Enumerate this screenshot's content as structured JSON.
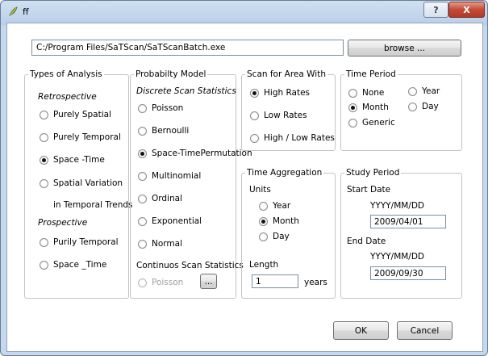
{
  "window": {
    "title": "ff",
    "help_label": "?",
    "close_label": "X"
  },
  "path": {
    "value": "C:/Program Files/SaTScan/SaTScanBatch.exe",
    "browse_label": "browse ..."
  },
  "analysis": {
    "title": "Types of Analysis",
    "retrospective_label": "Retrospective",
    "purely_spatial": "Purely Spatial",
    "purely_temporal": "Purely Temporal",
    "space_time": "Space -Time",
    "spatial_variation_1": "Spatial Variation",
    "spatial_variation_2": "in Temporal Trends",
    "prospective_label": "Prospective",
    "purily_temporal": "Purily Temporal",
    "space_time_prosp": "Space _Time",
    "selected": "space_time"
  },
  "model": {
    "title": "Probabilty Model",
    "discrete_label": "Discrete Scan Statistics",
    "poisson": "Poisson",
    "bernoulli": "Bernoulli",
    "space_time_perm": "Space-TimePermutation",
    "multinomial": "Multinomial",
    "ordinal": "Ordinal",
    "exponential": "Exponential",
    "normal": "Normal",
    "continuous_label": "Continuos Scan Statistics",
    "poisson_cont": "Poisson",
    "ellipsis_label": "...",
    "selected": "space_time_perm"
  },
  "scan_area": {
    "title": "Scan for Area With",
    "high": "High Rates",
    "low": "Low Rates",
    "high_low": "High / Low Rates",
    "selected": "high"
  },
  "time_period": {
    "title": "Time Period",
    "none": "None",
    "year": "Year",
    "month": "Month",
    "day": "Day",
    "generic": "Generic",
    "selected": "month"
  },
  "time_aggregation": {
    "title": "Time Aggregation",
    "units_label": "Units",
    "year": "Year",
    "month": "Month",
    "day": "Day",
    "selected": "month",
    "length_label": "Length",
    "length_value": "1",
    "length_unit": "years"
  },
  "study_period": {
    "title": "Study Period",
    "start_label": "Start Date",
    "start_format": "YYYY/MM/DD",
    "start_value": "2009/04/01",
    "end_label": "End Date",
    "end_format": "YYYY/MM/DD",
    "end_value": "2009/09/30"
  },
  "buttons": {
    "ok": "OK",
    "cancel": "Cancel"
  }
}
